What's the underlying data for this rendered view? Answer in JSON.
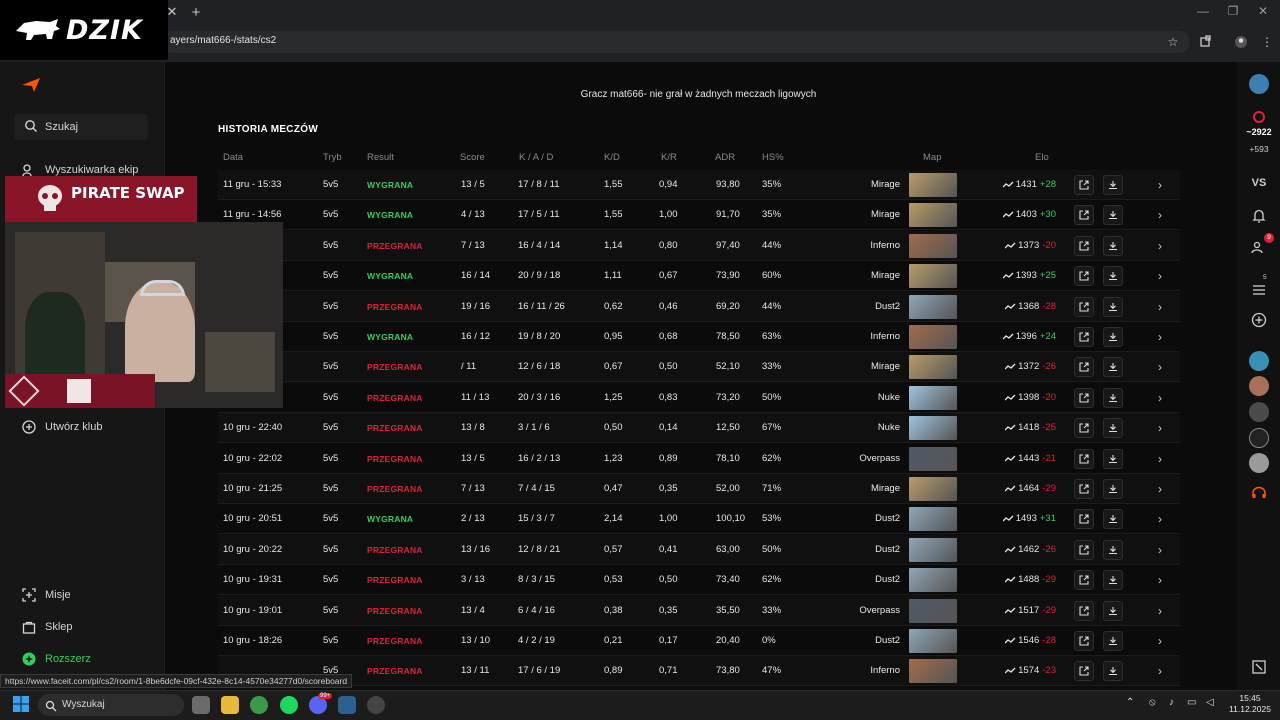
{
  "browser": {
    "url": "ayers/mat666-/stats/cs2",
    "status_url": "https://www.faceit.com/pl/cs2/room/1-8be6dcfe-09cf-432e-8c14-4570e34277d0/scoreboard"
  },
  "overlay": {
    "logo_text": "DZIK",
    "pirate_text": "PIRATE SWAP"
  },
  "sidebar": {
    "search_label": "Szukaj",
    "items": [
      {
        "label": "Wyszukiwarka ekip",
        "icon": "team-search-icon"
      },
      {
        "label": "Utwórz klub",
        "icon": "plus-circle-icon"
      },
      {
        "label": "Misje",
        "icon": "missions-icon"
      },
      {
        "label": "Sklep",
        "icon": "shop-icon"
      },
      {
        "label": "Rozszerz",
        "icon": "expand-icon"
      }
    ]
  },
  "main": {
    "notice": "Gracz mat666- nie grał w żadnych meczach ligowych",
    "section_title": "HISTORIA MECZÓW",
    "headers": [
      "Data",
      "Tryb",
      "Result",
      "Score",
      "K / A / D",
      "K/D",
      "K/R",
      "ADR",
      "HS%",
      "Map",
      "Elo"
    ],
    "rows": [
      {
        "date": "11 gru - 15:33",
        "mode": "5v5",
        "result": "WYGRANA",
        "score": "13 / 5",
        "kad": "17 / 8 / 11",
        "kd": "1,55",
        "kr": "0,94",
        "adr": "93,80",
        "hs": "35%",
        "map": "Mirage",
        "elo": "1431",
        "delta": "+28"
      },
      {
        "date": "11 gru - 14:56",
        "mode": "5v5",
        "result": "WYGRANA",
        "score": "4 / 13",
        "kad": "17 / 5 / 11",
        "kd": "1,55",
        "kr": "1,00",
        "adr": "91,70",
        "hs": "35%",
        "map": "Mirage",
        "elo": "1403",
        "delta": "+30"
      },
      {
        "date": "",
        "mode": "5v5",
        "result": "PRZEGRANA",
        "score": "7 / 13",
        "kad": "16 / 4 / 14",
        "kd": "1,14",
        "kr": "0,80",
        "adr": "97,40",
        "hs": "44%",
        "map": "Inferno",
        "elo": "1373",
        "delta": "-20"
      },
      {
        "date": "",
        "mode": "5v5",
        "result": "WYGRANA",
        "score": "16 / 14",
        "kad": "20 / 9 / 18",
        "kd": "1,11",
        "kr": "0,67",
        "adr": "73,90",
        "hs": "60%",
        "map": "Mirage",
        "elo": "1393",
        "delta": "+25"
      },
      {
        "date": "",
        "mode": "5v5",
        "result": "PRZEGRANA",
        "score": "19 / 16",
        "kad": "16 / 11 / 26",
        "kd": "0,62",
        "kr": "0,46",
        "adr": "69,20",
        "hs": "44%",
        "map": "Dust2",
        "elo": "1368",
        "delta": "-28"
      },
      {
        "date": "",
        "mode": "5v5",
        "result": "WYGRANA",
        "score": "16 / 12",
        "kad": "19 / 8 / 20",
        "kd": "0,95",
        "kr": "0,68",
        "adr": "78,50",
        "hs": "63%",
        "map": "Inferno",
        "elo": "1396",
        "delta": "+24"
      },
      {
        "date": "",
        "mode": "5v5",
        "result": "PRZEGRANA",
        "score": "  / 11",
        "kad": "12 / 6 / 18",
        "kd": "0,67",
        "kr": "0,50",
        "adr": "52,10",
        "hs": "33%",
        "map": "Mirage",
        "elo": "1372",
        "delta": "-26"
      },
      {
        "date": "",
        "mode": "5v5",
        "result": "PRZEGRANA",
        "score": "11 / 13",
        "kad": "20 / 3 / 16",
        "kd": "1,25",
        "kr": "0,83",
        "adr": "73,20",
        "hs": "50%",
        "map": "Nuke",
        "elo": "1398",
        "delta": "-20"
      },
      {
        "date": "10 gru - 22:40",
        "mode": "5v5",
        "result": "PRZEGRANA",
        "score": "13 / 8",
        "kad": "3 / 1 / 6",
        "kd": "0,50",
        "kr": "0,14",
        "adr": "12,50",
        "hs": "67%",
        "map": "Nuke",
        "elo": "1418",
        "delta": "-25"
      },
      {
        "date": "10 gru - 22:02",
        "mode": "5v5",
        "result": "PRZEGRANA",
        "score": "13 / 5",
        "kad": "16 / 2 / 13",
        "kd": "1,23",
        "kr": "0,89",
        "adr": "78,10",
        "hs": "62%",
        "map": "Overpass",
        "elo": "1443",
        "delta": "-21"
      },
      {
        "date": "10 gru - 21:25",
        "mode": "5v5",
        "result": "PRZEGRANA",
        "score": "7 / 13",
        "kad": "7 / 4 / 15",
        "kd": "0,47",
        "kr": "0,35",
        "adr": "52,00",
        "hs": "71%",
        "map": "Mirage",
        "elo": "1464",
        "delta": "-29"
      },
      {
        "date": "10 gru - 20:51",
        "mode": "5v5",
        "result": "WYGRANA",
        "score": "2 / 13",
        "kad": "15 / 3 / 7",
        "kd": "2,14",
        "kr": "1,00",
        "adr": "100,10",
        "hs": "53%",
        "map": "Dust2",
        "elo": "1493",
        "delta": "+31"
      },
      {
        "date": "10 gru - 20:22",
        "mode": "5v5",
        "result": "PRZEGRANA",
        "score": "13 / 16",
        "kad": "12 / 8 / 21",
        "kd": "0,57",
        "kr": "0,41",
        "adr": "63,00",
        "hs": "50%",
        "map": "Dust2",
        "elo": "1462",
        "delta": "-26"
      },
      {
        "date": "10 gru - 19:31",
        "mode": "5v5",
        "result": "PRZEGRANA",
        "score": "3 / 13",
        "kad": "8 / 3 / 15",
        "kd": "0,53",
        "kr": "0,50",
        "adr": "73,40",
        "hs": "62%",
        "map": "Dust2",
        "elo": "1488",
        "delta": "-29"
      },
      {
        "date": "10 gru - 19:01",
        "mode": "5v5",
        "result": "PRZEGRANA",
        "score": "13 / 4",
        "kad": "6 / 4 / 16",
        "kd": "0,38",
        "kr": "0,35",
        "adr": "35,50",
        "hs": "33%",
        "map": "Overpass",
        "elo": "1517",
        "delta": "-29"
      },
      {
        "date": "10 gru - 18:26",
        "mode": "5v5",
        "result": "PRZEGRANA",
        "score": "13 / 10",
        "kad": "4 / 2 / 19",
        "kd": "0,21",
        "kr": "0,17",
        "adr": "20,40",
        "hs": "0%",
        "map": "Dust2",
        "elo": "1546",
        "delta": "-28"
      },
      {
        "date": "",
        "mode": "5v5",
        "result": "PRZEGRANA",
        "score": "13 / 11",
        "kad": "17 / 6 / 19",
        "kd": "0,89",
        "kr": "0,71",
        "adr": "73,80",
        "hs": "47%",
        "map": "Inferno",
        "elo": "1574",
        "delta": "-23"
      }
    ]
  },
  "rail": {
    "elo_value": "~2922",
    "elo_delta": "+593",
    "vs_label": "VS",
    "badge_red": "9",
    "badge_count": "5"
  },
  "taskbar": {
    "search_label": "Wyszukaj",
    "time": "15:45",
    "date": "11.12.2025",
    "discord_badge": "99+"
  },
  "colors": {
    "win": "#2fd05a",
    "loss": "#e0213a",
    "accent": "#ff5500"
  }
}
